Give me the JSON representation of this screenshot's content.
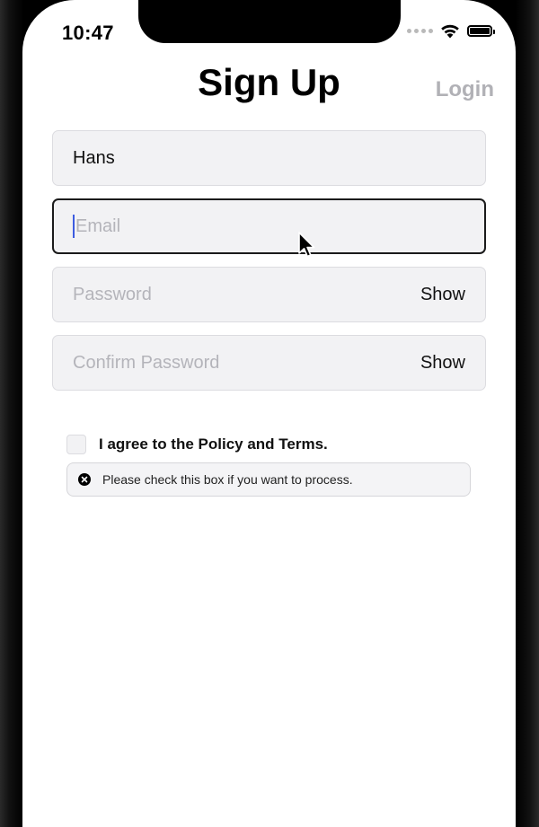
{
  "status_bar": {
    "time": "10:47",
    "icons": [
      "signal-dots-icon",
      "wifi-icon",
      "battery-icon"
    ]
  },
  "header": {
    "title": "Sign Up",
    "login_label": "Login"
  },
  "form": {
    "name": {
      "value": "Hans",
      "placeholder": ""
    },
    "email": {
      "value": "",
      "placeholder": "Email"
    },
    "password": {
      "value": "",
      "placeholder": "Password",
      "toggle_label": "Show"
    },
    "confirm_password": {
      "value": "",
      "placeholder": "Confirm Password",
      "toggle_label": "Show"
    },
    "agree": {
      "label": "I agree to the Policy and Terms.",
      "checked": false
    },
    "validation_message": "Please check this box if you want to process."
  },
  "colors": {
    "field_background": "#f2f2f4",
    "field_border": "#dcdce0",
    "focus_border": "#1b1b1b",
    "caret": "#3d5ce0",
    "muted_text": "#b1b1b6"
  }
}
